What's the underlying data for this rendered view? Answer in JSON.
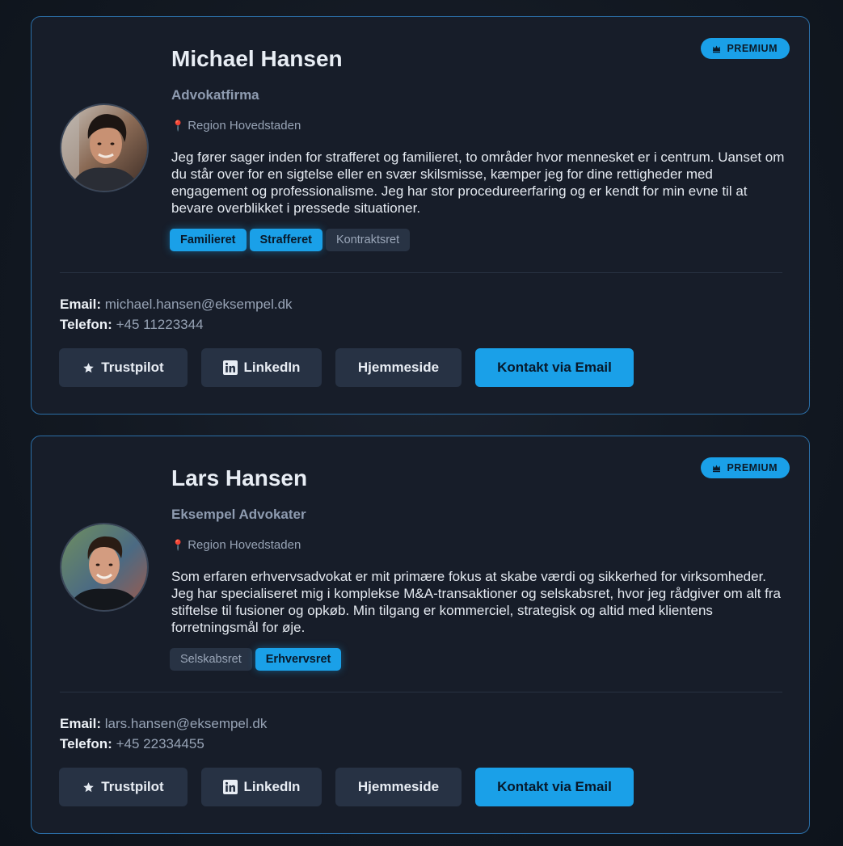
{
  "colors": {
    "accent": "#1aa0e8",
    "card_border": "#2b6ea6",
    "card_bg": "#171d29",
    "page_bg": "#121821",
    "tag_inactive_bg": "#283344",
    "button_bg": "#273244"
  },
  "lawyers": [
    {
      "badge": "PREMIUM",
      "badge_icon": "crown-icon",
      "avatar_icon": "profile-photo",
      "name": "Michael Hansen",
      "firm": "Advokatfirma",
      "region_icon": "location-pin-icon",
      "region": "Region Hovedstaden",
      "bio": "Jeg fører sager inden for strafferet og familieret, to områder hvor mennesket er i centrum. Uanset om du står over for en sigtelse eller en svær skilsmisse, kæmper jeg for dine rettigheder med engagement og professionalisme. Jeg har stor procedureerfaring og er kendt for min evne til at bevare overblikket i pressede situationer.",
      "tags": [
        {
          "label": "Familieret",
          "active": true
        },
        {
          "label": "Strafferet",
          "active": true
        },
        {
          "label": "Kontraktsret",
          "active": false
        }
      ],
      "email_label": "Email:",
      "email": "michael.hansen@eksempel.dk",
      "phone_label": "Telefon:",
      "phone": "+45 11223344",
      "buttons": {
        "trustpilot": "Trustpilot",
        "linkedin": "LinkedIn",
        "website": "Hjemmeside",
        "contact": "Kontakt via Email"
      }
    },
    {
      "badge": "PREMIUM",
      "badge_icon": "crown-icon",
      "avatar_icon": "profile-photo",
      "name": "Lars Hansen",
      "firm": "Eksempel Advokater",
      "region_icon": "location-pin-icon",
      "region": "Region Hovedstaden",
      "bio": "Som erfaren erhvervsadvokat er mit primære fokus at skabe værdi og sikkerhed for virksomheder. Jeg har specialiseret mig i komplekse M&A-transaktioner og selskabsret, hvor jeg rådgiver om alt fra stiftelse til fusioner og opkøb. Min tilgang er kommerciel, strategisk og altid med klientens forretningsmål for øje.",
      "tags": [
        {
          "label": "Selskabsret",
          "active": false
        },
        {
          "label": "Erhvervsret",
          "active": true
        }
      ],
      "email_label": "Email:",
      "email": "lars.hansen@eksempel.dk",
      "phone_label": "Telefon:",
      "phone": "+45 22334455",
      "buttons": {
        "trustpilot": "Trustpilot",
        "linkedin": "LinkedIn",
        "website": "Hjemmeside",
        "contact": "Kontakt via Email"
      }
    }
  ]
}
